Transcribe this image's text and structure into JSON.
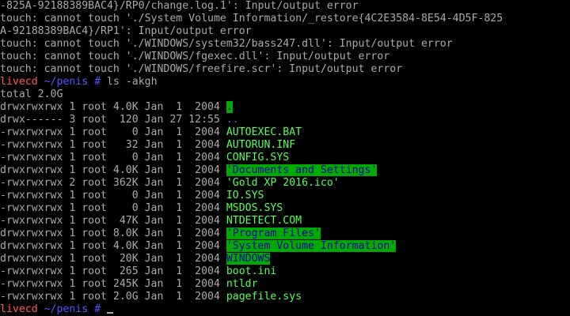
{
  "output": {
    "lines": [
      "-825A-92188389BAC4}/RP0/change.log.1': Input/output error",
      "touch: cannot touch './System Volume Information/_restore{4C2E3584-8E54-4D5F-825",
      "A-92188389BAC4}/RP1': Input/output error",
      "touch: cannot touch './WINDOWS/system32/bass247.dll': Input/output error",
      "touch: cannot touch './WINDOWS/fgexec.dll': Input/output error",
      "touch: cannot touch './WINDOWS/freefire.scr': Input/output error"
    ]
  },
  "prompt1": {
    "host": "livecd",
    "path": " ~/penis",
    "symbol": " #",
    "command": " ls -akgh"
  },
  "total": "total 2.0G",
  "listing": [
    {
      "meta": "drwxrwxrwx 1 root 4.0K Jan  1  2004 ",
      "name": ".",
      "style": "dir-green"
    },
    {
      "meta": "drwx------ 3 root  120 Jan 27 12:55 ",
      "name": "..",
      "style": "dir-plain"
    },
    {
      "meta": "-rwxrwxrwx 1 root    0 Jan  1  2004 ",
      "name": "AUTOEXEC.BAT",
      "style": "exec"
    },
    {
      "meta": "-rwxrwxrwx 1 root   32 Jan  1  2004 ",
      "name": "AUTORUN.INF",
      "style": "exec"
    },
    {
      "meta": "-rwxrwxrwx 1 root    0 Jan  1  2004 ",
      "name": "CONFIG.SYS",
      "style": "exec"
    },
    {
      "meta": "drwxrwxrwx 1 root 4.0K Jan  1  2004 ",
      "name": "'Documents and Settings'",
      "style": "dir-green"
    },
    {
      "meta": "-rwxrwxrwx 2 root 362K Jan  1  2004 ",
      "name": "'Gold XP 2016.ico'",
      "style": "exec"
    },
    {
      "meta": "-rwxrwxrwx 1 root    0 Jan  1  2004 ",
      "name": "IO.SYS",
      "style": "exec"
    },
    {
      "meta": "-rwxrwxrwx 1 root    0 Jan  1  2004 ",
      "name": "MSDOS.SYS",
      "style": "exec"
    },
    {
      "meta": "-rwxrwxrwx 1 root  47K Jan  1  2004 ",
      "name": "NTDETECT.COM",
      "style": "exec"
    },
    {
      "meta": "drwxrwxrwx 1 root 8.0K Jan  1  2004 ",
      "name": "'Program Files'",
      "style": "dir-green"
    },
    {
      "meta": "drwxrwxrwx 1 root 4.0K Jan  1  2004 ",
      "name": "'System Volume Information'",
      "style": "dir-green"
    },
    {
      "meta": "drwxrwxrwx 1 root  20K Jan  1  2004 ",
      "name": "WINDOWS",
      "style": "dir-green"
    },
    {
      "meta": "-rwxrwxrwx 1 root  265 Jan  1  2004 ",
      "name": "boot.ini",
      "style": "exec"
    },
    {
      "meta": "-rwxrwxrwx 1 root 245K Jan  1  2004 ",
      "name": "ntldr",
      "style": "exec"
    },
    {
      "meta": "-rwxrwxrwx 1 root 2.0G Jan  1  2004 ",
      "name": "pagefile.sys",
      "style": "exec"
    }
  ],
  "prompt2": {
    "host": "livecd",
    "path": " ~/penis",
    "symbol": " #",
    "command": " "
  },
  "colors": {
    "background": "#000000",
    "text": "#aaaaaa",
    "prompt_host": "#ff5555",
    "prompt_path": "#5555ff",
    "exec_file": "#55ff55",
    "dir_highlight_bg": "#00aa00",
    "dir_highlight_fg": "#0000aa"
  }
}
